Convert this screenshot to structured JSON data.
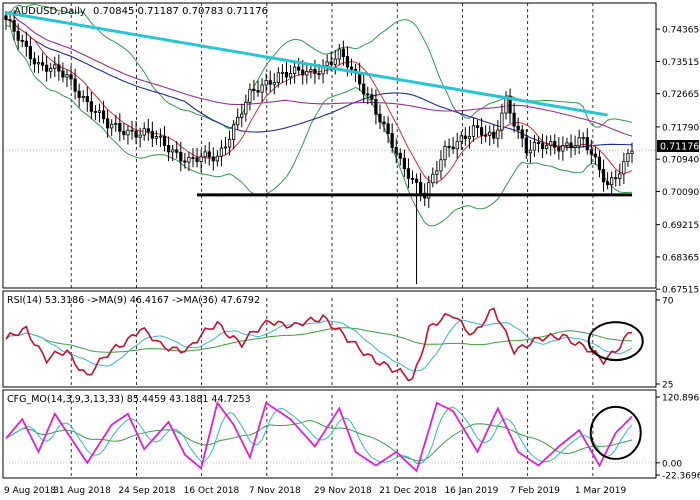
{
  "chart_data": {
    "type": "line",
    "symbol_header": "AUDUSD,Daily",
    "ohlc_header": "0.70845 0.71187 0.70783 0.71176",
    "current_price_label": "0.71176",
    "price_axis": {
      "ylim": [
        0.676,
        0.75
      ],
      "ticks": [
        "0.74365",
        "0.73515",
        "0.72665",
        "0.71790",
        "0.70940",
        "0.70090",
        "0.69215",
        "0.68365",
        "0.67515"
      ]
    },
    "date_labels": [
      "9 Aug 2018",
      "31 Aug 2018",
      "24 Sep 2018",
      "16 Oct 2018",
      "7 Nov 2018",
      "29 Nov 2018",
      "21 Dec 2018",
      "16 Jan 2019",
      "7 Feb 2019",
      "1 Mar 2019"
    ],
    "x_count": 155,
    "price_series": {
      "close_keypoints": [
        [
          0,
          0.7455
        ],
        [
          8,
          0.7345
        ],
        [
          15,
          0.731
        ],
        [
          25,
          0.718
        ],
        [
          35,
          0.716
        ],
        [
          45,
          0.709
        ],
        [
          52,
          0.71
        ],
        [
          60,
          0.726
        ],
        [
          67,
          0.732
        ],
        [
          75,
          0.732
        ],
        [
          82,
          0.737
        ],
        [
          90,
          0.725
        ],
        [
          97,
          0.708
        ],
        [
          103,
          0.7005
        ],
        [
          108,
          0.711
        ],
        [
          115,
          0.718
        ],
        [
          120,
          0.714
        ],
        [
          123,
          0.725
        ],
        [
          128,
          0.712
        ],
        [
          135,
          0.713
        ],
        [
          142,
          0.714
        ],
        [
          148,
          0.703
        ],
        [
          152,
          0.708
        ],
        [
          154,
          0.7118
        ]
      ],
      "spikes": [
        {
          "x": 101,
          "low": 0.6765
        }
      ]
    },
    "trendlines": [
      {
        "name": "resistance",
        "color": "#26c6d3",
        "from": [
          0,
          0.748
        ],
        "to": [
          148,
          0.721
        ]
      },
      {
        "name": "support",
        "color": "#000000",
        "from": [
          47,
          0.7
        ],
        "to": [
          154,
          0.7
        ]
      }
    ],
    "rsi": {
      "header": "RSI(14) 53.3186 ->MA(9) 46.4167 ->MA(36) 47.6792",
      "ylim": [
        25,
        70
      ],
      "ticks": [
        "70",
        "25"
      ],
      "keypoints": [
        [
          0,
          48
        ],
        [
          5,
          55
        ],
        [
          10,
          38
        ],
        [
          15,
          42
        ],
        [
          20,
          30
        ],
        [
          27,
          44
        ],
        [
          33,
          55
        ],
        [
          38,
          45
        ],
        [
          45,
          44
        ],
        [
          52,
          58
        ],
        [
          58,
          46
        ],
        [
          65,
          60
        ],
        [
          71,
          55
        ],
        [
          78,
          62
        ],
        [
          84,
          48
        ],
        [
          90,
          40
        ],
        [
          95,
          32
        ],
        [
          100,
          28
        ],
        [
          104,
          55
        ],
        [
          110,
          62
        ],
        [
          115,
          52
        ],
        [
          120,
          64
        ],
        [
          125,
          44
        ],
        [
          131,
          48
        ],
        [
          137,
          52
        ],
        [
          142,
          44
        ],
        [
          147,
          38
        ],
        [
          151,
          46
        ],
        [
          154,
          53
        ]
      ]
    },
    "oscillator": {
      "header": "CFG_MO(14,3,9,3,13,33) 85.4459 43.1881 44.7253",
      "ylim": [
        -22.3696,
        120.8967
      ],
      "ticks": [
        "120.8967",
        "0.00",
        "-22.3696"
      ],
      "keypoints": [
        [
          0,
          45
        ],
        [
          4,
          80
        ],
        [
          8,
          20
        ],
        [
          12,
          90
        ],
        [
          16,
          45
        ],
        [
          20,
          0
        ],
        [
          26,
          70
        ],
        [
          30,
          90
        ],
        [
          34,
          25
        ],
        [
          40,
          75
        ],
        [
          44,
          15
        ],
        [
          48,
          -10
        ],
        [
          52,
          110
        ],
        [
          56,
          70
        ],
        [
          60,
          10
        ],
        [
          64,
          110
        ],
        [
          70,
          80
        ],
        [
          76,
          30
        ],
        [
          82,
          100
        ],
        [
          86,
          20
        ],
        [
          91,
          -5
        ],
        [
          96,
          20
        ],
        [
          101,
          -15
        ],
        [
          106,
          110
        ],
        [
          110,
          95
        ],
        [
          116,
          20
        ],
        [
          121,
          100
        ],
        [
          126,
          20
        ],
        [
          131,
          -5
        ],
        [
          136,
          30
        ],
        [
          141,
          60
        ],
        [
          146,
          -5
        ],
        [
          150,
          55
        ],
        [
          154,
          85
        ]
      ]
    },
    "colors": {
      "candle_bull": "#000000",
      "candle_bear": "#000000",
      "ma_fast": "#e0302a",
      "ma_mid": "#1f2c9c",
      "ma_slow": "#9b2f9b",
      "bollinger": "#2e9e44",
      "rsi_line": "#c8102e",
      "rsi_ma9": "#34b7d4",
      "rsi_ma36": "#3aa03a",
      "osc_line": "#e020d8",
      "osc_ma": "#34b7d4",
      "osc_ma2": "#3aa03a",
      "annotation_circle": "#000000"
    }
  }
}
